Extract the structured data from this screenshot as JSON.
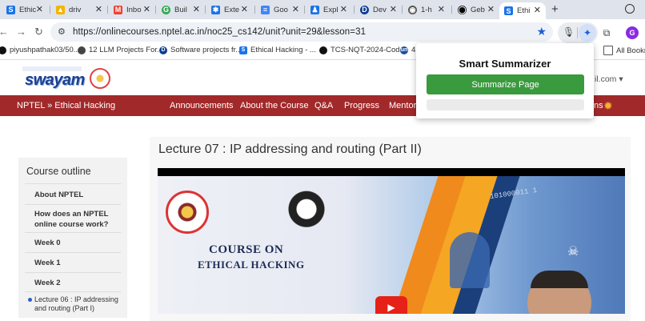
{
  "browser": {
    "tabs": [
      {
        "title": "Ethic",
        "favicon": "S",
        "color": "#1a73e8"
      },
      {
        "title": "driv",
        "favicon": "▲",
        "color": "#f4b400"
      },
      {
        "title": "Inbo",
        "favicon": "M",
        "color": "#ea4335"
      },
      {
        "title": "Buil",
        "favicon": "G",
        "color": "#34a853"
      },
      {
        "title": "Exte",
        "favicon": "✱",
        "color": "#1a73e8"
      },
      {
        "title": "Goo",
        "favicon": "≡",
        "color": "#4285f4"
      },
      {
        "title": "Expl",
        "favicon": "♟",
        "color": "#1a73e8"
      },
      {
        "title": "Dev",
        "favicon": "D",
        "color": "#0b3d91"
      },
      {
        "title": "1-h",
        "favicon": "◉",
        "color": "#555555"
      },
      {
        "title": "Geb",
        "favicon": "◯",
        "color": "#000000"
      },
      {
        "title": "Ethi",
        "favicon": "S",
        "color": "#1a73e8",
        "active": true
      }
    ],
    "url": "https://onlinecourses.nptel.ac.in/noc25_cs142/unit?unit=29&lesson=31",
    "profile_initial": "G",
    "bookmarks": [
      {
        "label": "piyushpathak03/50...",
        "icon": "github"
      },
      {
        "label": "12 LLM Projects For...",
        "icon": "globe"
      },
      {
        "label": "Software projects fr...",
        "icon": "D"
      },
      {
        "label": "Ethical Hacking - ...",
        "icon": "S"
      },
      {
        "label": "TCS-NQT-2024-Cod...",
        "icon": "github"
      },
      {
        "label": "4",
        "icon": "un"
      },
      {
        "label": "All Bookm",
        "icon": "folder"
      }
    ]
  },
  "site": {
    "logo_text": "swayam",
    "signin_partial": "il.com ▾",
    "breadcrumb": "NPTEL  »  Ethical Hacking",
    "menu": [
      "Announcements",
      "About the Course",
      "Q&A",
      "Progress",
      "Mentor"
    ],
    "menu_partial": "ns"
  },
  "sidebar": {
    "heading": "Course outline",
    "items": [
      "About NPTEL",
      "How does an NPTEL online course work?",
      "Week 0",
      "Week 1",
      "Week 2"
    ],
    "lesson": "Lecture 06 : IP addressing and routing (Part I)"
  },
  "main": {
    "lecture_title": "Lecture 07 : IP addressing and routing (Part II)",
    "video": {
      "course_line1": "COURSE ON",
      "course_line2": "ETHICAL HACKING",
      "binary_text": "101000011 1"
    }
  },
  "popup": {
    "title": "Smart Summarizer",
    "button": "Summarize Page"
  }
}
